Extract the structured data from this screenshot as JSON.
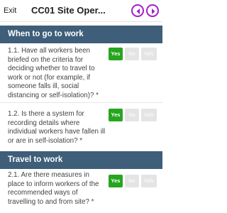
{
  "header": {
    "exit_label": "Exit",
    "title": "CC01 Site Oper..."
  },
  "colors": {
    "accent_nav": "#a020c8",
    "section_bg": "#3e5e79",
    "yes_selected": "#27a51f",
    "option_unselected": "#e4e4e4"
  },
  "sections": [
    {
      "title": "When to go to work",
      "questions": [
        {
          "text": "1.1. Have all workers been briefed on the criteria for deciding whether to travel to work or not (for example, if someone falls ill, social distancing or self-isolation)? *",
          "options": [
            "Yes",
            "No",
            "N/A"
          ],
          "selected": "Yes"
        },
        {
          "text": "1.2. Is there a system for recording details where individual workers have fallen ill or are in self-isolation? *",
          "options": [
            "Yes",
            "No",
            "N/A"
          ],
          "selected": "Yes"
        }
      ]
    },
    {
      "title": "Travel to work",
      "questions": [
        {
          "text": "2.1. Are there measures in place to inform workers of the recommended ways of travelling to and from site? *",
          "options": [
            "Yes",
            "No",
            "N/A"
          ],
          "selected": "Yes"
        }
      ]
    }
  ]
}
